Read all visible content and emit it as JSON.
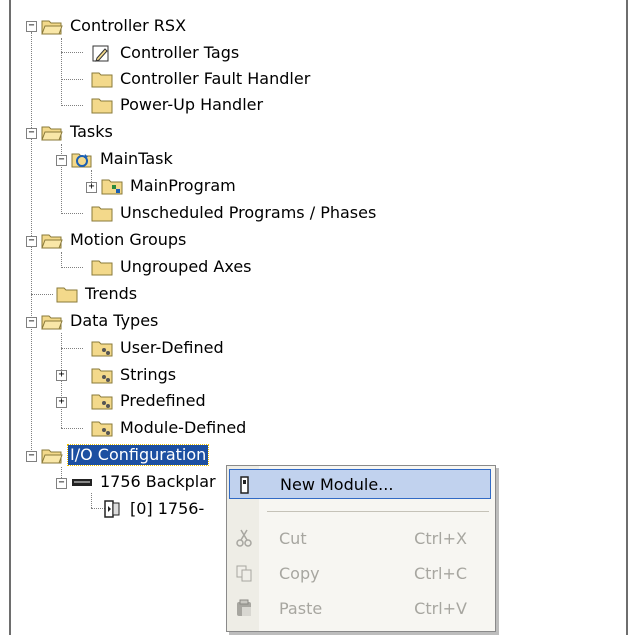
{
  "tree": {
    "nodes": [
      {
        "label": "Controller RSX",
        "icon": "folder-open-icon"
      },
      {
        "label": "Controller Tags",
        "icon": "tags-icon"
      },
      {
        "label": "Controller Fault Handler",
        "icon": "folder-icon"
      },
      {
        "label": "Power-Up Handler",
        "icon": "folder-icon"
      },
      {
        "label": "Tasks",
        "icon": "folder-open-icon"
      },
      {
        "label": "MainTask",
        "icon": "task-icon"
      },
      {
        "label": "MainProgram",
        "icon": "program-icon"
      },
      {
        "label": "Unscheduled Programs / Phases",
        "icon": "folder-icon"
      },
      {
        "label": "Motion Groups",
        "icon": "folder-open-icon"
      },
      {
        "label": "Ungrouped Axes",
        "icon": "folder-icon"
      },
      {
        "label": "Trends",
        "icon": "folder-icon"
      },
      {
        "label": "Data Types",
        "icon": "folder-open-icon"
      },
      {
        "label": "User-Defined",
        "icon": "datatype-folder-icon"
      },
      {
        "label": "Strings",
        "icon": "datatype-folder-icon"
      },
      {
        "label": "Predefined",
        "icon": "datatype-folder-icon"
      },
      {
        "label": "Module-Defined",
        "icon": "datatype-folder-icon"
      },
      {
        "label": "I/O Configuration",
        "icon": "folder-open-icon",
        "selected": true
      },
      {
        "label": "1756 Backplar",
        "icon": "backplane-icon"
      },
      {
        "label": "[0] 1756-",
        "icon": "module-icon"
      }
    ]
  },
  "context_menu": {
    "items": [
      {
        "label": "New Module...",
        "shortcut": "",
        "icon": "new-module-icon",
        "highlighted": true,
        "enabled": true
      },
      {
        "label": "Cut",
        "shortcut": "Ctrl+X",
        "icon": "scissors-icon",
        "enabled": false
      },
      {
        "label": "Copy",
        "shortcut": "Ctrl+C",
        "icon": "copy-icon",
        "enabled": false
      },
      {
        "label": "Paste",
        "shortcut": "Ctrl+V",
        "icon": "paste-icon",
        "enabled": false
      }
    ]
  },
  "colors": {
    "selection": "#1c4fa1",
    "menu_highlight": "#c1d2ee",
    "folder": "#f3d98b"
  }
}
